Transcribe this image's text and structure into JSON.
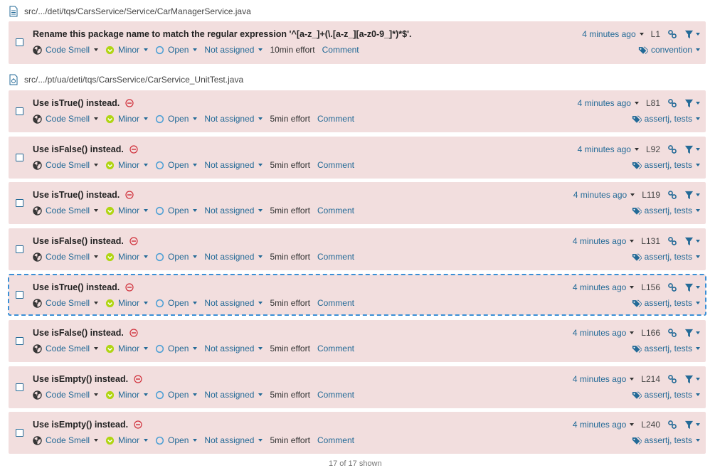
{
  "files": [
    {
      "path": "src/.../deti/tqs/CarsService/Service/CarManagerService.java"
    },
    {
      "path": "src/.../pt/ua/deti/tqs/CarsService/CarService_UnitTest.java"
    }
  ],
  "issues": [
    {
      "message": "Rename this package name to match the regular expression '^[a-z_]+(\\.[a-z_][a-z0-9_]*)*$'.",
      "type": "Code Smell",
      "severity": "Minor",
      "status": "Open",
      "assignee": "Not assigned",
      "effort": "10min effort",
      "comment": "Comment",
      "date": "4 minutes ago",
      "line": "L1",
      "tags": "convention"
    },
    {
      "message": "Use isTrue() instead.",
      "type": "Code Smell",
      "severity": "Minor",
      "status": "Open",
      "assignee": "Not assigned",
      "effort": "5min effort",
      "comment": "Comment",
      "date": "4 minutes ago",
      "line": "L81",
      "tags": "assertj, tests"
    },
    {
      "message": "Use isFalse() instead.",
      "type": "Code Smell",
      "severity": "Minor",
      "status": "Open",
      "assignee": "Not assigned",
      "effort": "5min effort",
      "comment": "Comment",
      "date": "4 minutes ago",
      "line": "L92",
      "tags": "assertj, tests"
    },
    {
      "message": "Use isTrue() instead.",
      "type": "Code Smell",
      "severity": "Minor",
      "status": "Open",
      "assignee": "Not assigned",
      "effort": "5min effort",
      "comment": "Comment",
      "date": "4 minutes ago",
      "line": "L119",
      "tags": "assertj, tests"
    },
    {
      "message": "Use isFalse() instead.",
      "type": "Code Smell",
      "severity": "Minor",
      "status": "Open",
      "assignee": "Not assigned",
      "effort": "5min effort",
      "comment": "Comment",
      "date": "4 minutes ago",
      "line": "L131",
      "tags": "assertj, tests"
    },
    {
      "message": "Use isTrue() instead.",
      "type": "Code Smell",
      "severity": "Minor",
      "status": "Open",
      "assignee": "Not assigned",
      "effort": "5min effort",
      "comment": "Comment",
      "date": "4 minutes ago",
      "line": "L156",
      "tags": "assertj, tests"
    },
    {
      "message": "Use isFalse() instead.",
      "type": "Code Smell",
      "severity": "Minor",
      "status": "Open",
      "assignee": "Not assigned",
      "effort": "5min effort",
      "comment": "Comment",
      "date": "4 minutes ago",
      "line": "L166",
      "tags": "assertj, tests"
    },
    {
      "message": "Use isEmpty() instead.",
      "type": "Code Smell",
      "severity": "Minor",
      "status": "Open",
      "assignee": "Not assigned",
      "effort": "5min effort",
      "comment": "Comment",
      "date": "4 minutes ago",
      "line": "L214",
      "tags": "assertj, tests"
    },
    {
      "message": "Use isEmpty() instead.",
      "type": "Code Smell",
      "severity": "Minor",
      "status": "Open",
      "assignee": "Not assigned",
      "effort": "5min effort",
      "comment": "Comment",
      "date": "4 minutes ago",
      "line": "L240",
      "tags": "assertj, tests"
    }
  ],
  "footer": {
    "text": "17 of 17 shown"
  },
  "colors": {
    "issue_bg": "#f2dede",
    "link": "#236a97",
    "minor": "#4b9fd5",
    "block_icon": "#d02f3a",
    "selection": "#3a8fd6"
  }
}
